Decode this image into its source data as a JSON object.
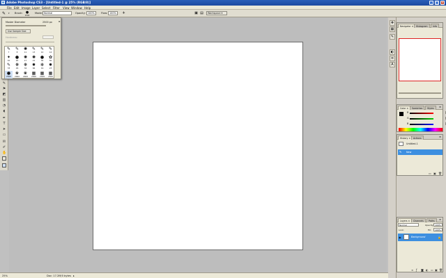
{
  "app": {
    "title": "Adobe Photoshop CS3 - [Untitled-1 @ 25% (RGB/8)]",
    "window_buttons": [
      "_",
      "□",
      "×"
    ]
  },
  "menu": [
    "File",
    "Edit",
    "Image",
    "Layer",
    "Select",
    "Filter",
    "View",
    "Window",
    "Help"
  ],
  "options": {
    "brush_label": "Brush:",
    "brush_size": "2500",
    "mode_label": "Mode:",
    "mode_value": "Normal",
    "opacity_label": "Opacity:",
    "opacity_value": "100%",
    "flow_label": "Flow:",
    "flow_value": "100%",
    "workspace_label": "Workspace ▾"
  },
  "brush_picker": {
    "master_diameter_label": "Master Diameter",
    "master_diameter_value": "2500 px",
    "use_sample_size": "Use Sample Size",
    "hardness_label": "Hardness:",
    "brushes": [
      {
        "glyph": "✎",
        "size": "7"
      },
      {
        "glyph": "✎",
        "size": "8"
      },
      {
        "glyph": "✺",
        "size": "11"
      },
      {
        "glyph": "✎",
        "size": "13"
      },
      {
        "glyph": "✎",
        "size": "12"
      },
      {
        "glyph": "✎",
        "size": "14"
      },
      {
        "glyph": "✦",
        "size": "10"
      },
      {
        "glyph": "●",
        "size": "20"
      },
      {
        "glyph": "✺",
        "size": "17"
      },
      {
        "glyph": "✺",
        "size": "21"
      },
      {
        "glyph": "●",
        "size": "30"
      },
      {
        "glyph": "✿",
        "size": "50"
      },
      {
        "glyph": "✎",
        "size": "33"
      },
      {
        "glyph": "❋",
        "size": "29"
      },
      {
        "glyph": "❋",
        "size": "34"
      },
      {
        "glyph": "✹",
        "size": "66"
      },
      {
        "glyph": "✻",
        "size": "19"
      },
      {
        "glyph": "✹",
        "size": "23"
      },
      {
        "glyph": "●",
        "size": "2500"
      },
      {
        "glyph": "❀",
        "size": "2462"
      },
      {
        "glyph": "❀",
        "size": "2464"
      },
      {
        "glyph": "▦",
        "size": "2500"
      },
      {
        "glyph": "▦",
        "size": "2499"
      },
      {
        "glyph": "▦",
        "size": "2500"
      }
    ]
  },
  "navigator": {
    "tabs": [
      "Navigator ×",
      "Histogram",
      "Info"
    ]
  },
  "color": {
    "tabs": [
      "Color ×",
      "Swatches",
      "Styles"
    ],
    "channels": [
      {
        "label": "R",
        "value": "0",
        "color": "#cc2222"
      },
      {
        "label": "G",
        "value": "0",
        "color": "#22aa22"
      },
      {
        "label": "B",
        "value": "0",
        "color": "#2244cc"
      }
    ]
  },
  "history": {
    "tabs": [
      "History ×",
      "Actions"
    ],
    "snapshot": "Untitled-1",
    "items": [
      "New"
    ]
  },
  "layers": {
    "tabs": [
      "Layers ×",
      "Channels",
      "Paths"
    ],
    "blend_mode": "Normal",
    "opacity": "100%",
    "lock_label": "Lock:",
    "fill": "100%",
    "layer_name": "Background"
  },
  "status": {
    "zoom": "25%",
    "doc": "Doc: 17.2M/0 bytes"
  },
  "colors": {
    "title_bar": "#1f4ea6",
    "selection": "#3d8fe0",
    "canvas": "#ffffff",
    "workspace": "#bdbdbd"
  }
}
